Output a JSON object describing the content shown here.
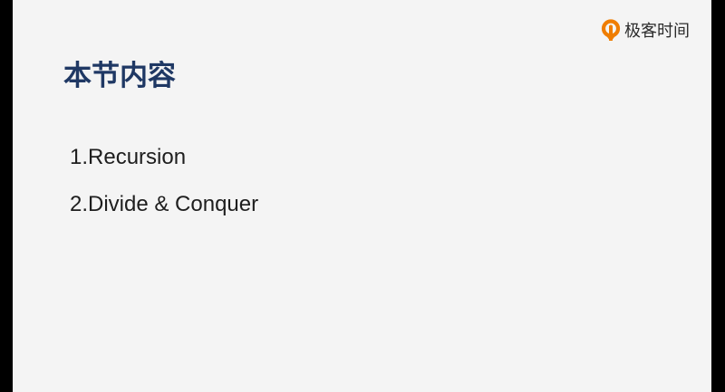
{
  "brand": {
    "logo_icon": "geektime-logo-icon",
    "name": "极客时间",
    "accent_color": "#ef7d00"
  },
  "slide": {
    "title": "本节内容",
    "title_color": "#1f3864",
    "items": [
      "1.Recursion",
      "2.Divide & Conquer"
    ]
  }
}
